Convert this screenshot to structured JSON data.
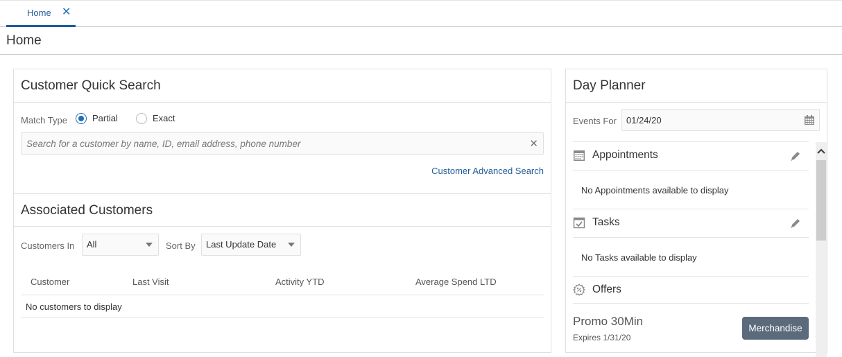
{
  "tabs": [
    {
      "label": "Home",
      "active": true,
      "closable": true
    }
  ],
  "page": {
    "title": "Home"
  },
  "quick_search": {
    "title": "Customer Quick Search",
    "match_type_label": "Match Type",
    "options": [
      {
        "label": "Partial",
        "checked": true
      },
      {
        "label": "Exact",
        "checked": false
      }
    ],
    "search_placeholder": "Search for a customer by name, ID, email address, phone number",
    "search_value": "",
    "advanced_link": "Customer Advanced Search"
  },
  "associated": {
    "title": "Associated Customers",
    "customers_in_label": "Customers In",
    "customers_in_value": "All",
    "sort_by_label": "Sort By",
    "sort_by_value": "Last Update Date",
    "columns": [
      "Customer",
      "Last Visit",
      "Activity YTD",
      "Average Spend LTD"
    ],
    "empty_message": "No customers to display"
  },
  "day_planner": {
    "title": "Day Planner",
    "events_for_label": "Events For",
    "date_value": "01/24/20",
    "appointments": {
      "title": "Appointments",
      "empty": "No Appointments available to display"
    },
    "tasks": {
      "title": "Tasks",
      "empty": "No Tasks available to display"
    },
    "offers": {
      "title": "Offers",
      "items": [
        {
          "name": "Promo 30Min",
          "expires": "Expires 1/31/20",
          "category": "Merchandise"
        }
      ]
    }
  },
  "colors": {
    "accent": "#1f5c99",
    "radio": "#1f6fb5",
    "button": "#5b6b7c"
  }
}
